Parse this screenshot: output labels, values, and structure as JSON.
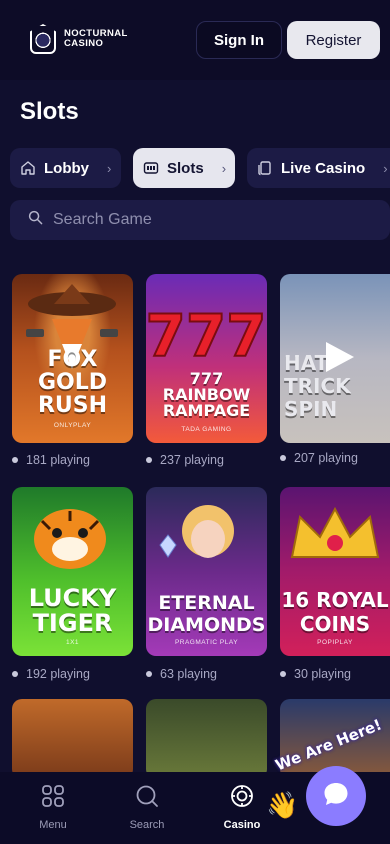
{
  "brand": {
    "line1": "NOCTURNAL",
    "line2": "CASINO"
  },
  "header": {
    "signin_label": "Sign In",
    "register_label": "Register"
  },
  "page": {
    "title": "Slots"
  },
  "categories": [
    {
      "label": "Lobby",
      "icon": "home-icon",
      "active": false
    },
    {
      "label": "Slots",
      "icon": "slot-machine-icon",
      "active": true
    },
    {
      "label": "Live Casino",
      "icon": "cards-icon",
      "active": false
    }
  ],
  "search": {
    "placeholder": "Search Game"
  },
  "games": [
    {
      "title": "FOX GOLD RUSH",
      "provider": "ONLYPLAY",
      "playing": "181 playing"
    },
    {
      "title": "777 RAINBOW RAMPAGE",
      "provider": "TADA GAMING",
      "playing": "237 playing"
    },
    {
      "title": "HAT-TRICK SPIN",
      "provider": "",
      "playing": "207 playing"
    },
    {
      "title": "LUCKY TIGER",
      "provider": "1X1",
      "playing": "192 playing"
    },
    {
      "title": "ETERNAL DIAMONDS",
      "provider": "PRAGMATIC PLAY",
      "playing": "63 playing"
    },
    {
      "title": "16 ROYAL COINS",
      "provider": "POPIPLAY",
      "playing": "30 playing"
    }
  ],
  "bottom_nav": [
    {
      "label": "Menu",
      "icon": "grid-icon",
      "active": false
    },
    {
      "label": "Search",
      "icon": "search-icon",
      "active": false
    },
    {
      "label": "Casino",
      "icon": "casino-chip-icon",
      "active": true
    }
  ],
  "chat": {
    "bubble_text": "We Are Here!"
  },
  "colors": {
    "background": "#100f2e",
    "surface": "#1c1b45",
    "accent": "#8b7cff"
  }
}
